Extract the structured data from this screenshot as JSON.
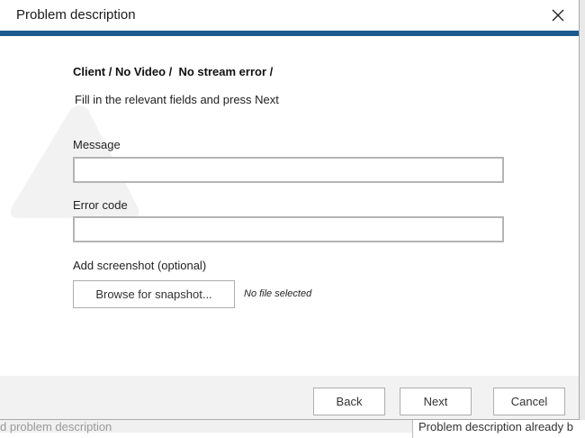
{
  "dialog": {
    "title": "Problem description",
    "breadcrumb": "Client / No Video /  No stream error /",
    "instructions": "Fill in the relevant fields and press Next"
  },
  "fields": {
    "message_label": "Message",
    "message_value": "",
    "error_code_label": "Error code",
    "error_code_value": ""
  },
  "screenshot": {
    "label": "Add screenshot (optional)",
    "browse_button": "Browse for snapshot...",
    "status": "No file selected"
  },
  "buttons": {
    "back": "Back",
    "next": "Next",
    "cancel": "Cancel"
  },
  "background": {
    "left_text": "d problem description",
    "right_text": "Problem description already b"
  },
  "colors": {
    "accent": "#1b5c8e",
    "footer_bg": "#f2f2f2",
    "input_border": "#b4b4b4"
  }
}
